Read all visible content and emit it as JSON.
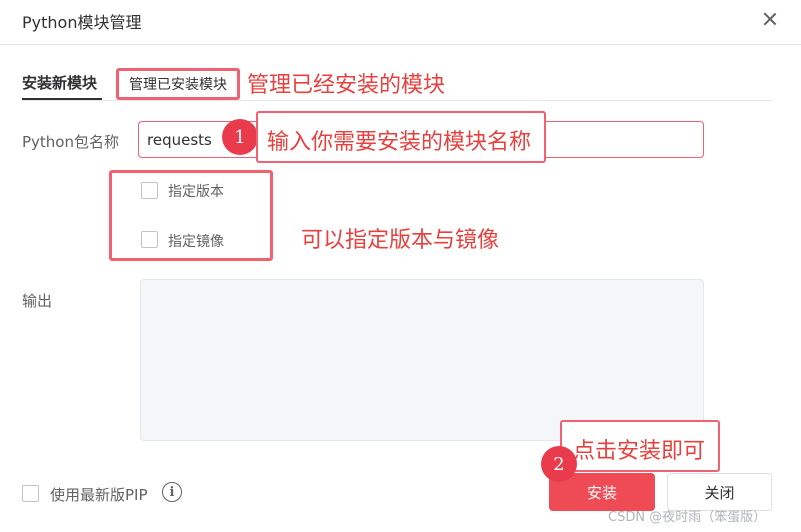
{
  "dialog": {
    "title": "Python模块管理"
  },
  "tabs": [
    {
      "label": "安装新模块"
    },
    {
      "label": "管理已安装模块"
    }
  ],
  "annotations": {
    "manage_installed": "管理已经安装的模块",
    "enter_module_name": "输入你需要安装的模块名称",
    "version_mirror": "可以指定版本与镜像",
    "click_install": "点击安装即可",
    "badge_1": "1",
    "badge_2": "2"
  },
  "form": {
    "package_label": "Python包名称",
    "package_value": "requests",
    "specify_version_label": "指定版本",
    "specify_mirror_label": "指定镜像",
    "output_label": "输出",
    "use_latest_pip_label": "使用最新版PIP",
    "info_icon_glyph": "i"
  },
  "buttons": {
    "install": "安装",
    "close": "关闭"
  },
  "watermark": "CSDN @夜时雨（笨蛋版）"
}
